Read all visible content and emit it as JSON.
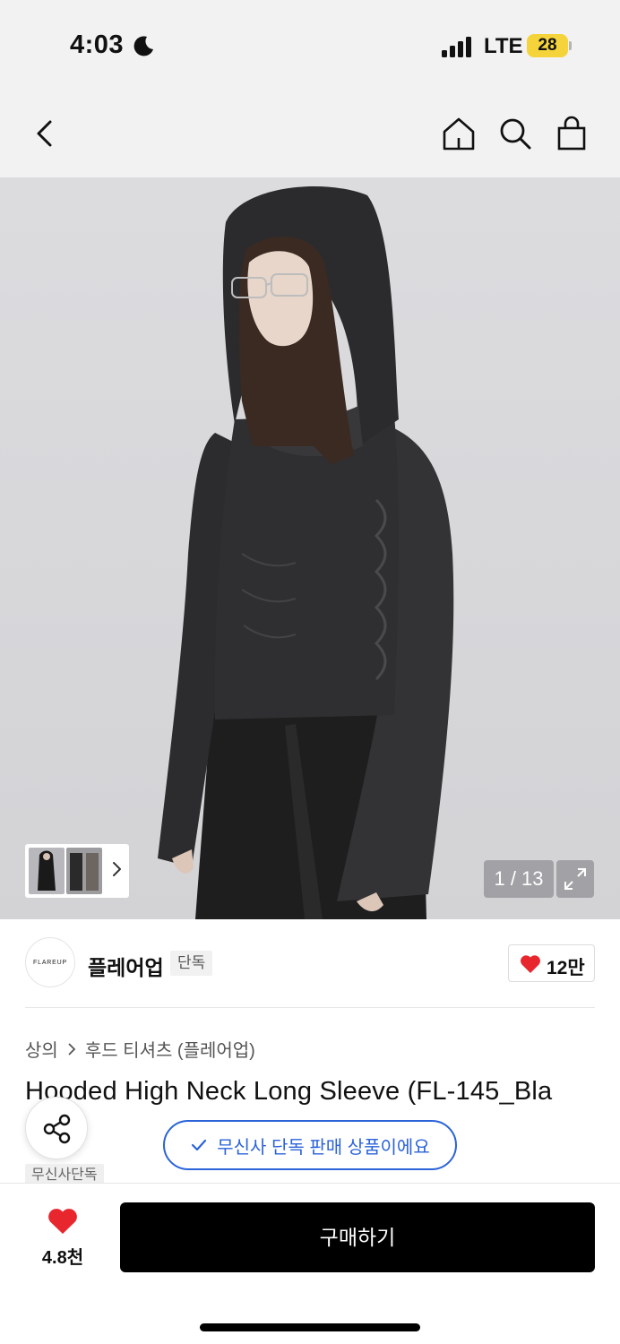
{
  "status_bar": {
    "time": "4:03",
    "network": "LTE",
    "battery": "28"
  },
  "nav": {
    "icons": [
      "back-arrow-icon",
      "home-icon",
      "search-icon",
      "shopping-bag-icon"
    ]
  },
  "gallery": {
    "counter": "1 / 13",
    "icons": [
      "chevron-right-icon",
      "expand-icon"
    ]
  },
  "brand": {
    "logo_text": "FLAREUP",
    "name": "플레어업",
    "tag": "단독",
    "like_count": "12만"
  },
  "breadcrumb": {
    "category": "상의",
    "subcategory": "후드 티셔츠 (플레어업)"
  },
  "product": {
    "title": "Hooded High Neck Long Sleeve (FL-145_Bla",
    "exclusive_notice": "무신사 단독 판매 상품이에요",
    "exclusive_badge": "무신사단독"
  },
  "bottom_bar": {
    "wish_count": "4.8천",
    "buy_label": "구매하기"
  },
  "colors": {
    "accent_blue": "#2b63d9",
    "heart_red": "#e8262e",
    "battery_yellow": "#f5d33a",
    "buy_button": "#000000"
  }
}
